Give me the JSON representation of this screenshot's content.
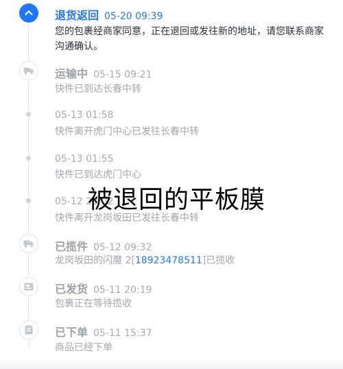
{
  "events": [
    {
      "status": "退货返回",
      "time": "05-20 09:39",
      "desc": "您的包裹经商家同意，正在退回或发往新的地址，请您联系商家沟通确认。",
      "icon": "chevron-up-icon"
    },
    {
      "status": "运输中",
      "time": "05-15 09:21",
      "desc": "快件已到达长春中转",
      "icon": "truck-icon"
    },
    {
      "time": "05-13 01:58",
      "desc": "快件离开虎门中心已发往长春中转"
    },
    {
      "time": "05-13 01:55",
      "desc": "快件已到达虎门中心"
    },
    {
      "time": "05-12 23:02",
      "desc": "快件离开龙岗坂田已发往长春中转"
    },
    {
      "status": "已揽件",
      "time": "05-12 09:32",
      "desc_prefix": "龙岗坂田的闪魔 2[",
      "phone": "18923478511",
      "desc_suffix": "]已揽收",
      "icon": "courier-truck-icon"
    },
    {
      "status": "已发货",
      "time": "05-11 20:19",
      "desc": "包裹正在等待揽收",
      "icon": "package-icon"
    },
    {
      "status": "已下单",
      "time": "05-11 15:37",
      "desc": "商品已经下单",
      "icon": "order-document-icon"
    }
  ],
  "overlay_text": "被退回的平板膜",
  "colors": {
    "accent": "#1f77ff",
    "muted": "#a3a7ad",
    "text": "#2b2f36"
  }
}
